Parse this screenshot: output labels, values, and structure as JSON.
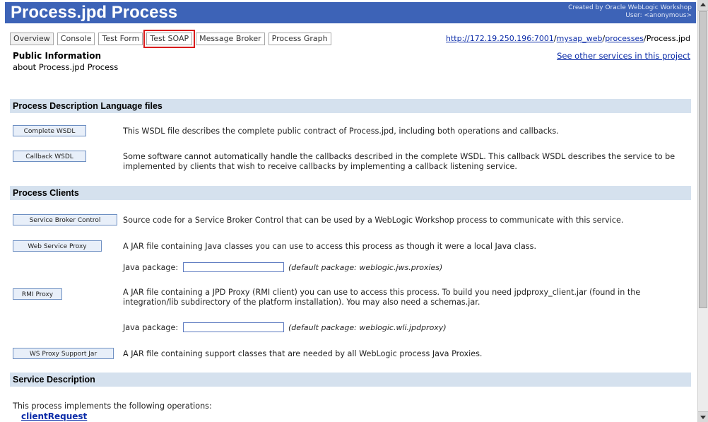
{
  "header": {
    "title": "Process.jpd Process",
    "created_by": "Created by Oracle WebLogic Workshop",
    "user": "User: <anonymous>"
  },
  "tabs": [
    {
      "label": "Overview"
    },
    {
      "label": "Console"
    },
    {
      "label": "Test Form"
    },
    {
      "label": "Test SOAP"
    },
    {
      "label": "Message Broker"
    },
    {
      "label": "Process Graph"
    }
  ],
  "url": {
    "base": "http://172.19.250.196:7001",
    "sep1": "/",
    "part2": "mysap_web",
    "sep2": "/",
    "part3": "processes",
    "file": "/Process.jpd"
  },
  "public_info": {
    "title": "Public Information",
    "subtitle": "about Process.jpd Process",
    "other_services_link": "See other services in this project"
  },
  "sections": {
    "pdl": "Process Description Language files",
    "clients": "Process Clients",
    "service_desc": "Service Description"
  },
  "pdl_files": {
    "complete_wsdl_btn": "Complete WSDL",
    "complete_wsdl_desc": "This WSDL file describes the complete public contract of Process.jpd, including both operations and callbacks.",
    "callback_wsdl_btn": "Callback WSDL",
    "callback_wsdl_desc_1": "Some software cannot automatically handle the callbacks described in the complete WSDL. This callback WSDL describes the service to be",
    "callback_wsdl_desc_2": "implemented by clients that wish to receive callbacks by implementing a callback listening service."
  },
  "clients": {
    "sbc_btn": "Service Broker Control",
    "sbc_desc": "Source code for a Service Broker Control that can be used by a WebLogic Workshop process to communicate with this service.",
    "wsp_btn": "Web Service Proxy",
    "wsp_desc": "A JAR file containing Java classes you can use to access this process as though it were a local Java class.",
    "wsp_pkg_label": "Java package:",
    "wsp_pkg_value": "",
    "wsp_pkg_default": "(default package: weblogic.jws.proxies)",
    "rmi_btn": "RMI Proxy",
    "rmi_desc_1": "A JAR file containing a JPD Proxy (RMI client) you can use to access this process. To build you need jpdproxy_client.jar (found in the",
    "rmi_desc_2": "integration/lib subdirectory of the platform installation). You may also need a schemas.jar.",
    "rmi_pkg_label": "Java package:",
    "rmi_pkg_value": "",
    "rmi_pkg_default": "(default package: weblogic.wli.jpdproxy)",
    "wsjar_btn": "WS Proxy Support Jar",
    "wsjar_desc": "A JAR file containing support classes that are needed by all WebLogic process Java Proxies."
  },
  "service_description": {
    "intro": "This process implements the following operations:",
    "operation_link": "clientRequest"
  },
  "colors": {
    "title_bar": "#3d63b7",
    "section_bar": "#d5e1ee",
    "link": "#0a2ba8",
    "highlight": "#d91b1b"
  }
}
